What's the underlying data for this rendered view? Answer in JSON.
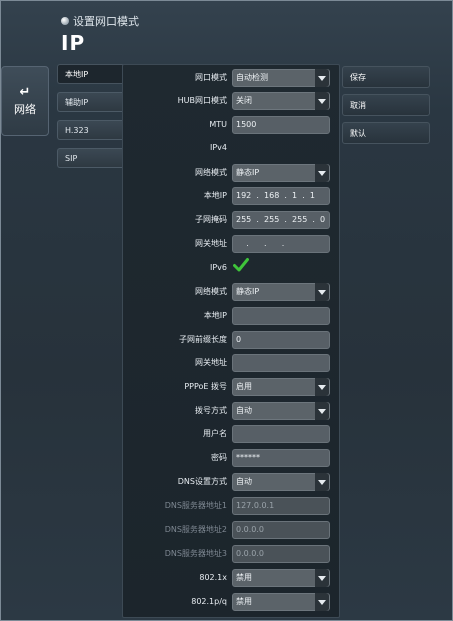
{
  "header": {
    "breadcrumb": "设置网口模式",
    "title": "IP"
  },
  "back": {
    "label": "网络",
    "icon": "back-arrow-icon"
  },
  "tabs": [
    {
      "label": "本地IP",
      "active": true
    },
    {
      "label": "辅助IP",
      "active": false
    },
    {
      "label": "H.323",
      "active": false
    },
    {
      "label": "SIP",
      "active": false
    }
  ],
  "actions": {
    "save": "保存",
    "cancel": "取消",
    "default": "默认"
  },
  "form": {
    "port_mode": {
      "label": "网口模式",
      "value": "自动检测"
    },
    "hub_mode": {
      "label": "HUB网口模式",
      "value": "关闭"
    },
    "mtu": {
      "label": "MTU",
      "value": "1500"
    },
    "ipv4_section": "IPv4",
    "ipv4_net_mode": {
      "label": "网络模式",
      "value": "静态IP"
    },
    "ipv4_local_ip": {
      "label": "本地IP",
      "octets": [
        "192",
        "168",
        "1",
        "1"
      ]
    },
    "ipv4_mask": {
      "label": "子网掩码",
      "octets": [
        "255",
        "255",
        "255",
        "0"
      ]
    },
    "ipv4_gateway": {
      "label": "网关地址",
      "octets": [
        "",
        "",
        "",
        ""
      ]
    },
    "ipv6_section": {
      "label": "IPv6",
      "checked": true
    },
    "ipv6_net_mode": {
      "label": "网络模式",
      "value": "静态IP"
    },
    "ipv6_local_ip": {
      "label": "本地IP",
      "value": ""
    },
    "ipv6_prefix": {
      "label": "子网前缀长度",
      "value": "0"
    },
    "ipv6_gateway": {
      "label": "网关地址",
      "value": ""
    },
    "pppoe": {
      "label": "PPPoE 拨号",
      "value": "启用"
    },
    "dial_mode": {
      "label": "拨号方式",
      "value": "自动"
    },
    "username": {
      "label": "用户名",
      "value": ""
    },
    "password": {
      "label": "密码",
      "value": "******"
    },
    "dns_mode": {
      "label": "DNS设置方式",
      "value": "自动"
    },
    "dns1": {
      "label": "DNS服务器地址1",
      "value": "127.0.0.1"
    },
    "dns2": {
      "label": "DNS服务器地址2",
      "value": "0.0.0.0"
    },
    "dns3": {
      "label": "DNS服务器地址3",
      "value": "0.0.0.0"
    },
    "dot1x": {
      "label": "802.1x",
      "value": "禁用"
    },
    "dot1pq": {
      "label": "802.1p/q",
      "value": "禁用"
    }
  },
  "colors": {
    "check": "#3fc43a",
    "panel": "#1f2930",
    "field": "#575f66"
  }
}
